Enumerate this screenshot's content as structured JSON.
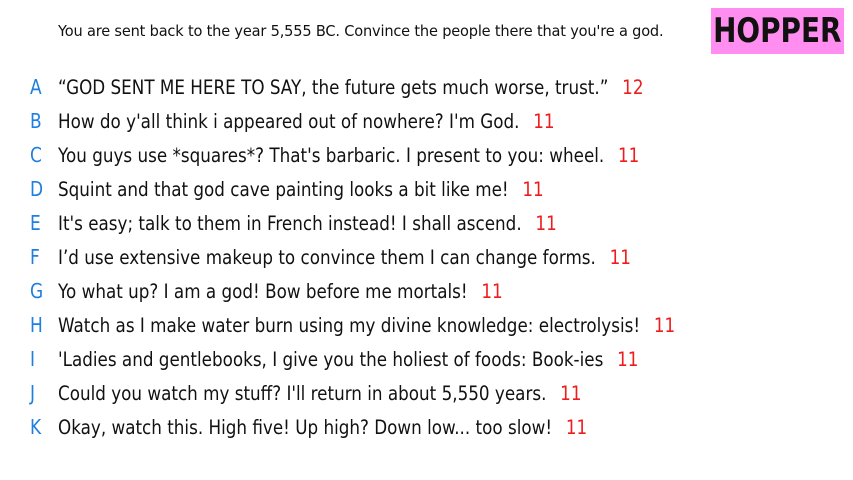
{
  "prompt": "You are sent back to the year 5,555 BC. Convince the people there that you're a god.",
  "brand": "HOPPER",
  "colors": {
    "letter": "#1e7fe0",
    "score": "#ee1c1c",
    "brand_bg": "#ff8ef0"
  },
  "answers": [
    {
      "letter": "A",
      "text": "“GOD SENT ME HERE TO SAY, the future gets much worse, trust.”",
      "score": "12"
    },
    {
      "letter": "B",
      "text": "How do y'all think i appeared out of nowhere? I'm God.",
      "score": "11"
    },
    {
      "letter": "C",
      "text": "You guys use *squares*? That's barbaric. I present to you: wheel.",
      "score": "11"
    },
    {
      "letter": "D",
      "text": "Squint and that god cave painting looks a bit like me!",
      "score": "11"
    },
    {
      "letter": "E",
      "text": "It's easy; talk to them in French instead! I shall ascend.",
      "score": "11"
    },
    {
      "letter": "F",
      "text": "I’d use extensive makeup to convince them I can change forms.",
      "score": "11"
    },
    {
      "letter": "G",
      "text": "Yo what up? I am a god! Bow before me mortals!",
      "score": "11"
    },
    {
      "letter": "H",
      "text": "Watch as I make water burn using my divine knowledge: electrolysis!",
      "score": "11"
    },
    {
      "letter": "I",
      "text": "'Ladies and gentlebooks, I give you the holiest of foods: Book-ies",
      "score": "11"
    },
    {
      "letter": "J",
      "text": "Could you watch my stuff? I'll return in about 5,550 years.",
      "score": "11"
    },
    {
      "letter": "K",
      "text": "Okay, watch this. High five! Up high? Down low... too slow!",
      "score": "11"
    }
  ]
}
